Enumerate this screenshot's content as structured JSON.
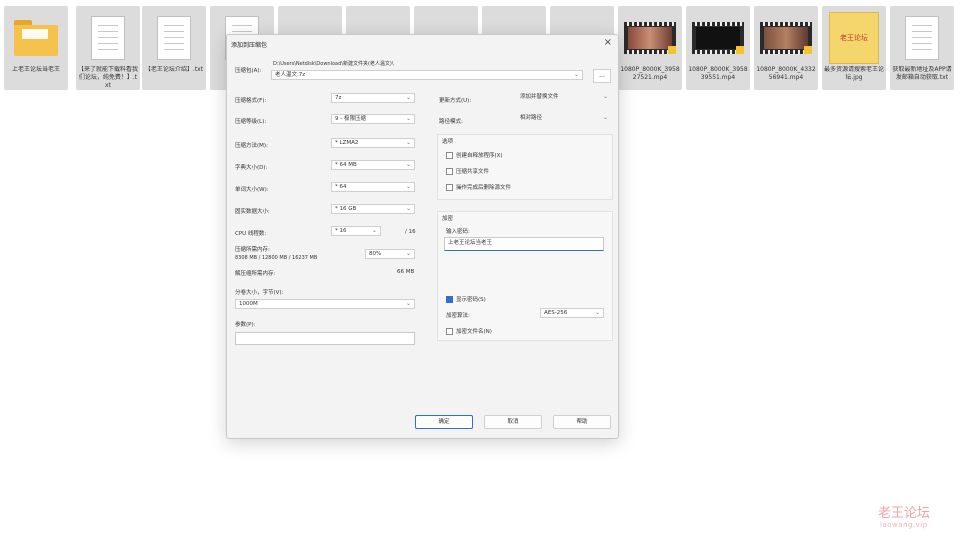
{
  "files": [
    {
      "kind": "folder",
      "name": "上老王论坛当老王"
    },
    {
      "kind": "doc",
      "name": "【来了就能下载料看我们论坛，纯免费！】.txt"
    },
    {
      "kind": "doc",
      "name": "【老王论坛介绍】.txt"
    },
    {
      "kind": "doc",
      "name": "【..."
    },
    {
      "kind": "blank",
      "name": ""
    },
    {
      "kind": "blank",
      "name": ""
    },
    {
      "kind": "blank",
      "name": ""
    },
    {
      "kind": "blank",
      "name": ""
    },
    {
      "kind": "blank",
      "name": ""
    },
    {
      "kind": "video",
      "name": "1080P_8000K_395827521.mp4"
    },
    {
      "kind": "video",
      "name": "1080P_8000K_395839551.mp4"
    },
    {
      "kind": "video",
      "name": "1080P_8000K_433256941.mp4"
    },
    {
      "kind": "qr",
      "name": "最多资源请搜索老王论坛.jpg",
      "thumb_text": "老王论坛"
    },
    {
      "kind": "doc",
      "name": "获取最新地址及APP请发邮箱自动获取.txt"
    }
  ],
  "dialog": {
    "title": "添加到压缩包",
    "close": "×",
    "archive_label": "压缩包(A):",
    "archive_path": "D:\\Users\\Netdisk\\Download\\新建文件夹(老人温文)\\",
    "archive_name": "老人温文.7z",
    "browse": "...",
    "format_label": "压缩格式(F):",
    "format_value": "7z",
    "level_label": "压缩等级(L):",
    "level_value": "9 - 极限压缩",
    "method_label": "压缩方法(M):",
    "method_value": "* LZMA2",
    "dict_label": "字典大小(D):",
    "dict_value": "* 64 MB",
    "word_label": "单词大小(W):",
    "word_value": "* 64",
    "solid_label": "固实数据大小:",
    "solid_value": "* 16 GB",
    "cpu_label": "CPU 线程数:",
    "cpu_value": "* 16",
    "cpu_max": "/ 16",
    "mem_label": "压缩所需内存:",
    "mem_detail": "8308 MB / 12800 MB / 16237 MB",
    "mem_percent": "80%",
    "decomp_label": "解压缩所需内存:",
    "decomp_value": "66 MB",
    "split_label": "分卷大小，字节(V):",
    "split_value": "1000M",
    "params_label": "参数(P):",
    "params_value": "",
    "update_label": "更新方式(U):",
    "update_value": "添加并替换文件",
    "path_mode_label": "路径模式:",
    "path_mode_value": "相对路径",
    "options_title": "选项",
    "opt1": "创建自释放程序(X)",
    "opt2": "压缩共享文件",
    "opt3": "操作完成后删除源文件",
    "enc_title": "加密",
    "pwd_label": "输入密码:",
    "pwd_value": "上老王论坛当老王",
    "show_pwd": "显示密码(S)",
    "enc_method_label": "加密算法:",
    "enc_method_value": "AES-256",
    "enc_names": "加密文件名(N)",
    "ok": "确定",
    "cancel": "取消",
    "help": "帮助"
  },
  "watermark": {
    "cn": "老王论坛",
    "en": "laowang.vip"
  },
  "colors": {
    "accent": "#2f6fd1",
    "folder": "#f5c24c",
    "tile": "#dcdcdc"
  }
}
